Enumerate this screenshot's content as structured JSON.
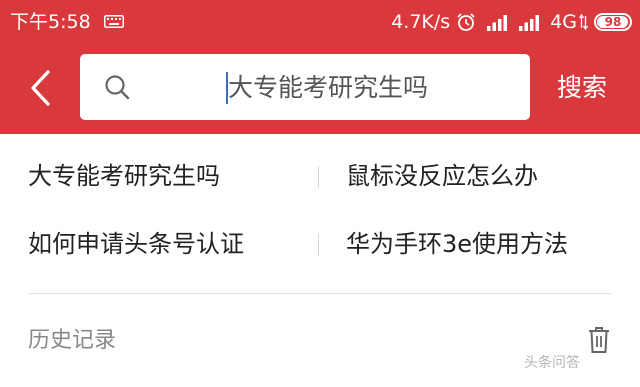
{
  "status_bar": {
    "time": "下午5:58",
    "net_speed": "4.7K/s",
    "net_type": "4G",
    "battery": "98",
    "battery_level": 0.98
  },
  "search": {
    "placeholder": "大专能考研究生吗",
    "button_label": "搜索"
  },
  "suggestions": [
    {
      "left": "大专能考研究生吗",
      "right": "鼠标没反应怎么办"
    },
    {
      "left": "如何申请头条号认证",
      "right": "华为手环3e使用方法"
    }
  ],
  "history": {
    "title": "历史记录"
  },
  "watermark": "头条问答",
  "colors": {
    "header_red": "#d9393d",
    "cursor_blue": "#3b6fb6"
  },
  "icons": [
    "keyboard-icon",
    "alarm-icon",
    "signal-icon",
    "back-arrow-icon",
    "search-icon",
    "trash-icon"
  ]
}
